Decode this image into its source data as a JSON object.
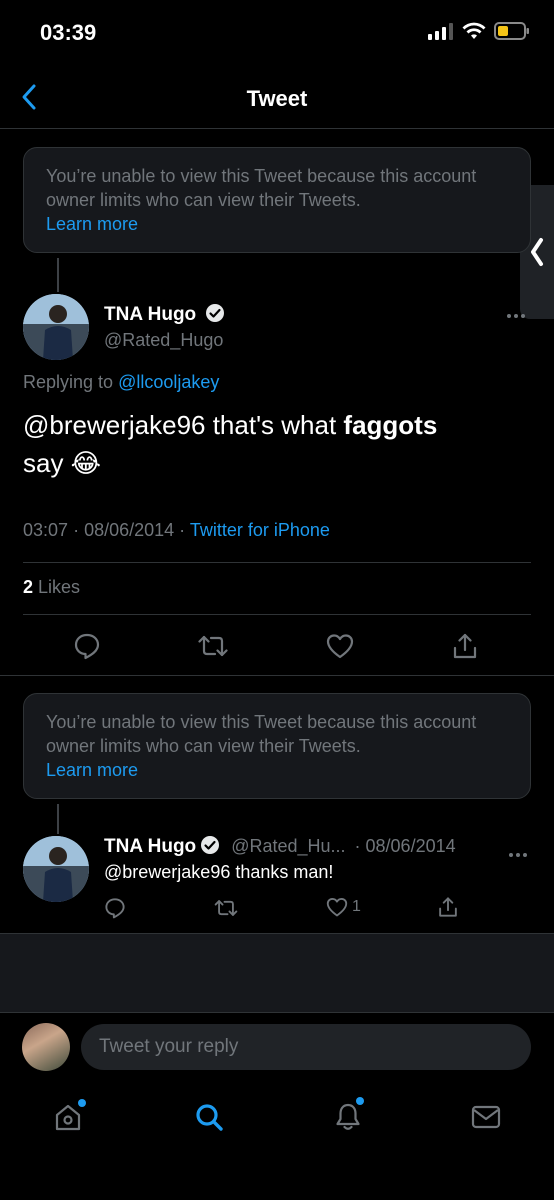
{
  "status_bar": {
    "time": "03:39"
  },
  "nav": {
    "title": "Tweet",
    "back_icon": "chevron-left-icon"
  },
  "notice": {
    "text": "You’re unable to view this Tweet because this account owner limits who can view their Tweets.",
    "link": "Learn more"
  },
  "main_tweet": {
    "name": "TNA Hugo",
    "handle": "@Rated_Hugo",
    "replying_prefix": "Replying to ",
    "replying_to": "@llcooljakey",
    "text_part1": "@brewerjake96 that's what ",
    "text_bold": "faggots",
    "text_part2": "say 😂",
    "time": "03:07",
    "date": "08/06/2014",
    "source": "Twitter for iPhone",
    "likes_count": "2",
    "likes_label": " Likes",
    "more_icon": "more-icon"
  },
  "notice2": {
    "text": "You’re unable to view this Tweet because this account owner limits who can view their Tweets.",
    "link": "Learn more"
  },
  "reply_tweet": {
    "name": "TNA Hugo",
    "handle": "@Rated_Hu...",
    "date": "· 08/06/2014",
    "text": "@brewerjake96 thanks man!",
    "like_count": "1"
  },
  "composer": {
    "placeholder": "Tweet your reply"
  },
  "tabs": [
    "home",
    "search",
    "notifications",
    "messages"
  ],
  "colors": {
    "accent": "#1d9bf0",
    "background": "#000000",
    "muted": "#71767b"
  }
}
